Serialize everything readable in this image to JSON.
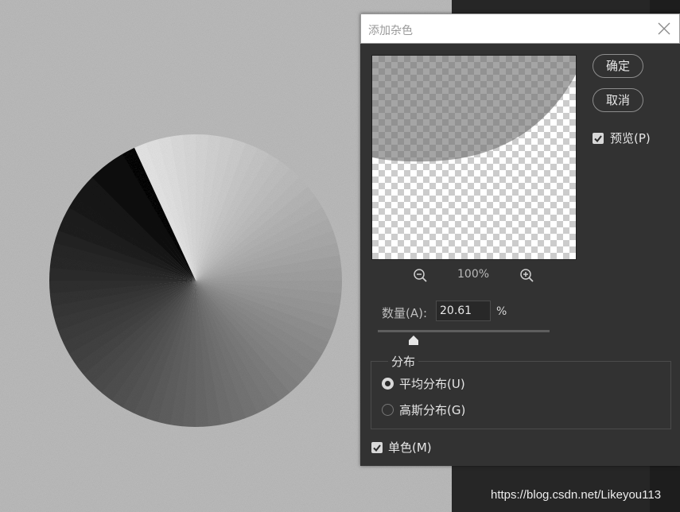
{
  "dialog": {
    "title": "添加杂色",
    "ok_label": "确定",
    "cancel_label": "取消",
    "preview_label": "预览(P)",
    "preview_checked": true,
    "zoom_level": "100%",
    "amount_label": "数量(A):",
    "amount_value": "20.61",
    "amount_unit": "%",
    "amount_slider_percent": 20.61,
    "distribution_label": "分布",
    "distribution_options": [
      {
        "label": "平均分布(U)",
        "selected": true
      },
      {
        "label": "高斯分布(G)",
        "selected": false
      }
    ],
    "monochromatic_label": "单色(M)",
    "monochromatic_checked": true
  },
  "watermark": "https://blog.csdn.net/Likeyou113",
  "icons": {
    "close": "close-icon",
    "zoom_out": "zoom-out-icon",
    "zoom_in": "zoom-in-icon",
    "check": "checkmark-icon"
  },
  "colors": {
    "dialog_bg": "#323232",
    "canvas_bg": "#bcbcbc"
  }
}
